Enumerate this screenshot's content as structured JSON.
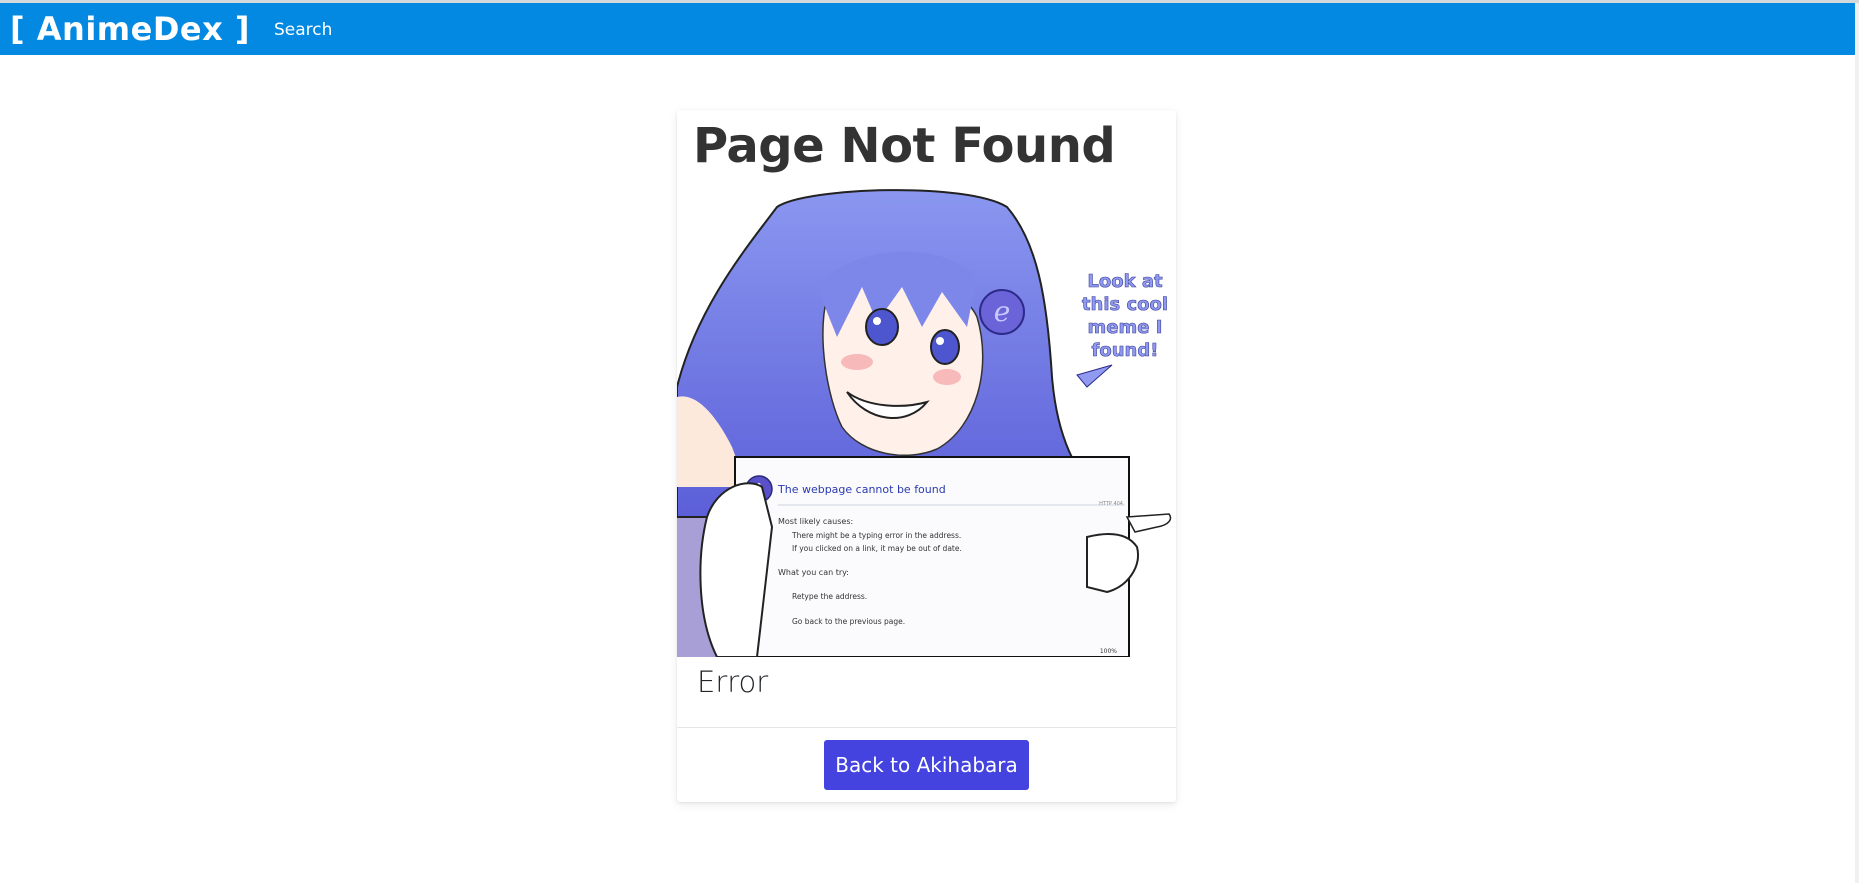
{
  "navbar": {
    "brand": "[ AnimeDex ]",
    "links": [
      {
        "label": "Search"
      }
    ]
  },
  "card": {
    "title": "Page Not Found",
    "illustration": {
      "speech_bubble_lines": [
        "Look at",
        "this cool",
        "meme I",
        "found!"
      ],
      "dialog": {
        "title": "The webpage cannot be found",
        "code": "HTTP 404",
        "causes_heading": "Most likely causes:",
        "causes": [
          "There might be a typing error in the address.",
          "If you clicked on a link, it may be out of date."
        ],
        "try_heading": "What you can try:",
        "actions": [
          "Retype the address.",
          "Go back to the previous page."
        ],
        "zoom": "100%"
      }
    },
    "text": "Error",
    "button_label": "Back to Akihabara"
  },
  "colors": {
    "navbar": "#0389e1",
    "button": "#4443e0",
    "hair": "#7b86e8",
    "title_text": "#333333"
  },
  "icons": {
    "info": "info-icon",
    "logo": "internet-explorer-logo"
  }
}
